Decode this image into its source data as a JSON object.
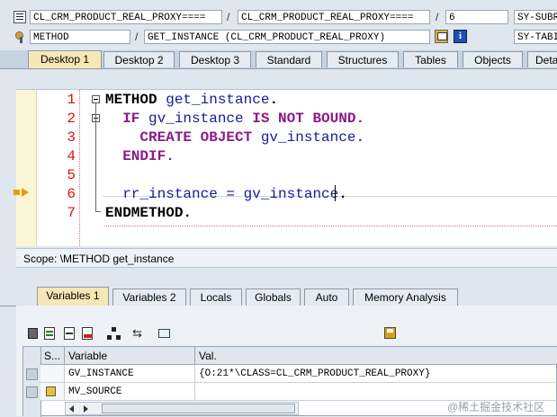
{
  "toolbar_row1": {
    "class_field": "CL_CRM_PRODUCT_REAL_PROXY====",
    "class_field2": "CL_CRM_PRODUCT_REAL_PROXY====",
    "line_field": "6",
    "sysfield": "SY-SUBR",
    "separator": "/"
  },
  "toolbar_row2": {
    "type_field": "METHOD",
    "name_field": "GET_INSTANCE (CL_CRM_PRODUCT_REAL_PROXY)",
    "sysfield": "SY-TABI",
    "separator": "/"
  },
  "tabs": [
    "Desktop 1",
    "Desktop 2",
    "Desktop 3",
    "Standard",
    "Structures",
    "Tables",
    "Objects",
    "Deta"
  ],
  "code_lines": [
    {
      "num": "1",
      "html_segments": [
        [
          "kwd",
          "METHOD "
        ],
        [
          "id",
          "get_instance"
        ],
        [
          "kwd",
          "."
        ]
      ]
    },
    {
      "num": "2",
      "html_segments": [
        [
          "",
          "  "
        ],
        [
          "kw",
          "IF "
        ],
        [
          "id",
          "gv_instance "
        ],
        [
          "kw",
          "IS NOT BOUND"
        ],
        [
          "kw",
          "."
        ]
      ]
    },
    {
      "num": "3",
      "html_segments": [
        [
          "",
          "    "
        ],
        [
          "kw",
          "CREATE OBJECT "
        ],
        [
          "id",
          "gv_instance"
        ],
        [
          "kw",
          "."
        ]
      ]
    },
    {
      "num": "4",
      "html_segments": [
        [
          "",
          "  "
        ],
        [
          "kw",
          "ENDIF"
        ],
        [
          "kw",
          "."
        ]
      ]
    },
    {
      "num": "5",
      "html_segments": []
    },
    {
      "num": "6",
      "html_segments": [
        [
          "",
          "  "
        ],
        [
          "id",
          "rr_instance = gv_instance"
        ],
        [
          "kwd",
          "."
        ]
      ]
    },
    {
      "num": "7",
      "html_segments": [
        [
          "kwd",
          "ENDMETHOD"
        ],
        [
          "kwd",
          "."
        ]
      ]
    }
  ],
  "scope_text": "Scope: \\METHOD get_instance",
  "var_tabs": [
    "Variables 1",
    "Variables 2",
    "Locals",
    "Globals",
    "Auto",
    "Memory Analysis"
  ],
  "table": {
    "headers": [
      "S...",
      "Variable",
      "Val."
    ],
    "rows": [
      {
        "variable": "GV_INSTANCE",
        "value": "{O:21*\\CLASS=CL_CRM_PRODUCT_REAL_PROXY}"
      },
      {
        "variable": "MV_SOURCE",
        "value": ""
      }
    ]
  },
  "watermark": "@稀土掘金技术社区",
  "colors": {
    "active_tab": "#f7e7b6",
    "line_number": "#dd1111",
    "keyword": "#8a1a8a"
  }
}
